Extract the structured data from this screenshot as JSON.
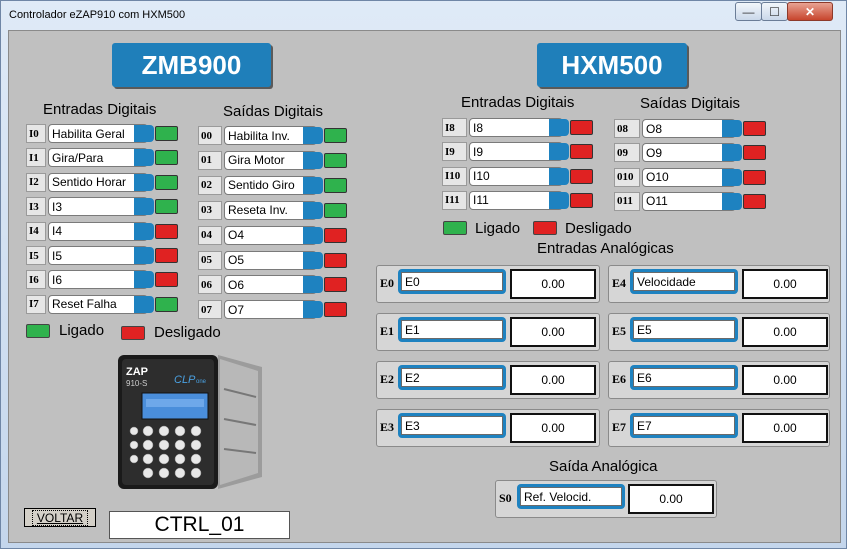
{
  "window": {
    "title": "Controlador eZAP910 com HXM500",
    "min_glyph": "—",
    "max_glyph": "☐",
    "close_glyph": "✕"
  },
  "zmb": {
    "header": "ZMB900",
    "inputs_title": "Entradas Digitais",
    "outputs_title": "Saídas Digitais",
    "inputs": [
      {
        "tag": "I0",
        "label": "Habilita Geral",
        "state": "on"
      },
      {
        "tag": "I1",
        "label": "Gira/Para",
        "state": "on"
      },
      {
        "tag": "I2",
        "label": "Sentido Horar",
        "state": "on"
      },
      {
        "tag": "I3",
        "label": "I3",
        "state": "on"
      },
      {
        "tag": "I4",
        "label": "I4",
        "state": "off"
      },
      {
        "tag": "I5",
        "label": "I5",
        "state": "off"
      },
      {
        "tag": "I6",
        "label": "I6",
        "state": "off"
      },
      {
        "tag": "I7",
        "label": "Reset Falha",
        "state": "on"
      }
    ],
    "outputs": [
      {
        "tag": "00",
        "label": "Habilita Inv.",
        "state": "on"
      },
      {
        "tag": "01",
        "label": "Gira Motor",
        "state": "on"
      },
      {
        "tag": "02",
        "label": "Sentido Giro",
        "state": "on"
      },
      {
        "tag": "03",
        "label": "Reseta Inv.",
        "state": "on"
      },
      {
        "tag": "04",
        "label": "O4",
        "state": "off"
      },
      {
        "tag": "05",
        "label": "O5",
        "state": "off"
      },
      {
        "tag": "06",
        "label": "O6",
        "state": "off"
      },
      {
        "tag": "07",
        "label": "O7",
        "state": "off"
      }
    ],
    "legend": {
      "on": "Ligado",
      "off": "Desligado"
    }
  },
  "hxm": {
    "header": "HXM500",
    "inputs_title": "Entradas Digitais",
    "outputs_title": "Saídas Digitais",
    "inputs": [
      {
        "tag": "I8",
        "label": "I8",
        "state": "off"
      },
      {
        "tag": "I9",
        "label": "I9",
        "state": "off"
      },
      {
        "tag": "I10",
        "label": "I10",
        "state": "off"
      },
      {
        "tag": "I11",
        "label": "I11",
        "state": "off"
      }
    ],
    "outputs": [
      {
        "tag": "08",
        "label": "O8",
        "state": "off"
      },
      {
        "tag": "09",
        "label": "O9",
        "state": "off"
      },
      {
        "tag": "010",
        "label": "O10",
        "state": "off"
      },
      {
        "tag": "011",
        "label": "O11",
        "state": "off"
      }
    ],
    "legend": {
      "on": "Ligado",
      "off": "Desligado"
    },
    "analog_title": "Entradas Analógicas",
    "analog_inputs": [
      {
        "tag": "E0",
        "label": "E0",
        "value": "0.00"
      },
      {
        "tag": "E1",
        "label": "E1",
        "value": "0.00"
      },
      {
        "tag": "E2",
        "label": "E2",
        "value": "0.00"
      },
      {
        "tag": "E3",
        "label": "E3",
        "value": "0.00"
      },
      {
        "tag": "E4",
        "label": "Velocidade",
        "value": "0.00"
      },
      {
        "tag": "E5",
        "label": "E5",
        "value": "0.00"
      },
      {
        "tag": "E6",
        "label": "E6",
        "value": "0.00"
      },
      {
        "tag": "E7",
        "label": "E7",
        "value": "0.00"
      }
    ],
    "analog_output_title": "Saída Analógica",
    "analog_output": {
      "tag": "S0",
      "label": "Ref. Velocid.",
      "value": "0.00"
    }
  },
  "footer": {
    "back_button": "VOLTAR",
    "ctrl_id": "CTRL_01"
  },
  "device": {
    "brand": "ZAP",
    "model": "910-S",
    "logo": "CLP",
    "logo_suffix": "one"
  },
  "colors": {
    "accent": "#1f7fba",
    "led_on": "#2fb24d",
    "led_off": "#e02222",
    "panel": "#c0c0c0"
  }
}
